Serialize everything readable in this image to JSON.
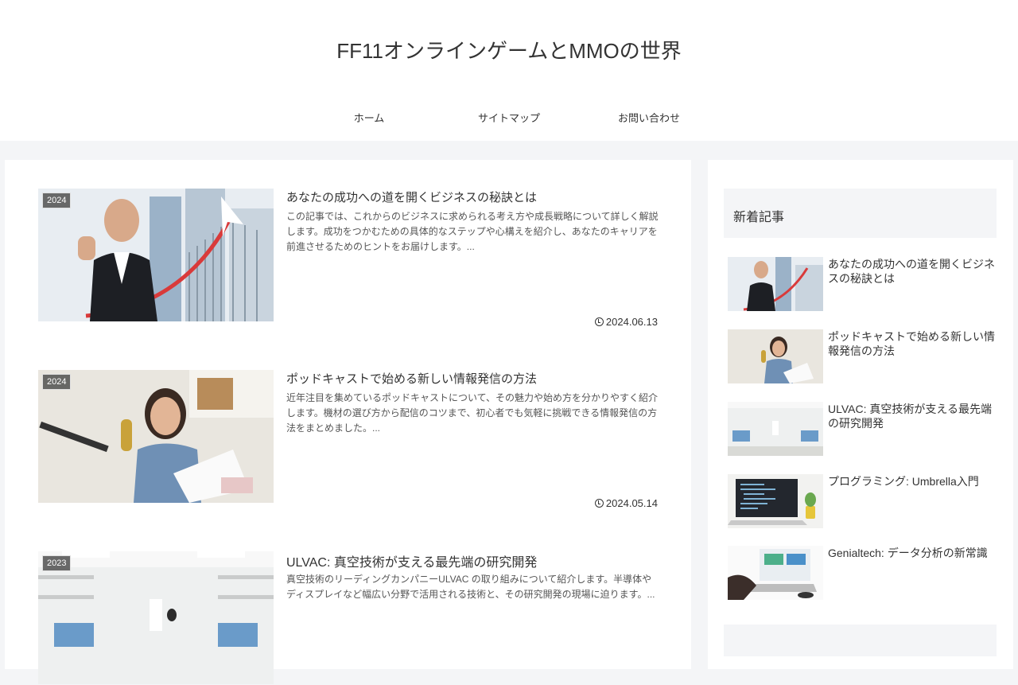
{
  "site": {
    "title": "FF11オンラインゲームとMMOの世界"
  },
  "nav": [
    "ホーム",
    "サイトマップ",
    "お問い合わせ"
  ],
  "posts": [
    {
      "category": "2024",
      "title": "あなたの成功への道を開くビジネスの秘訣とは",
      "excerpt": "この記事では、これからのビジネスに求められる考え方や成長戦略について詳しく解説します。成功をつかむための具体的なステップや心構えを紹介し、あなたのキャリアを前進させるためのヒントをお届けします。...",
      "date": "2024.06.13"
    },
    {
      "category": "2024",
      "title": "ポッドキャストで始める新しい情報発信の方法",
      "excerpt": "近年注目を集めているポッドキャストについて、その魅力や始め方を分かりやすく紹介します。機材の選び方から配信のコツまで、初心者でも気軽に挑戦できる情報発信の方法をまとめました。...",
      "date": "2024.05.14"
    },
    {
      "category": "2023",
      "title": "ULVAC: 真空技術が支える最先端の研究開発",
      "excerpt": "真空技術のリーディングカンパニーULVAC の取り組みについて紹介します。半導体やディスプレイなど幅広い分野で活用される技術と、その研究開発の現場に迫ります。...",
      "date": ""
    }
  ],
  "sidebar": {
    "widget_title": "新着記事",
    "items": [
      "あなたの成功への道を開くビジネスの秘訣とは",
      "ポッドキャストで始める新しい情報発信の方法",
      "ULVAC: 真空技術が支える最先端の研究開発",
      "プログラミング: Umbrella入門",
      "Genialtech: データ分析の新常識"
    ]
  }
}
